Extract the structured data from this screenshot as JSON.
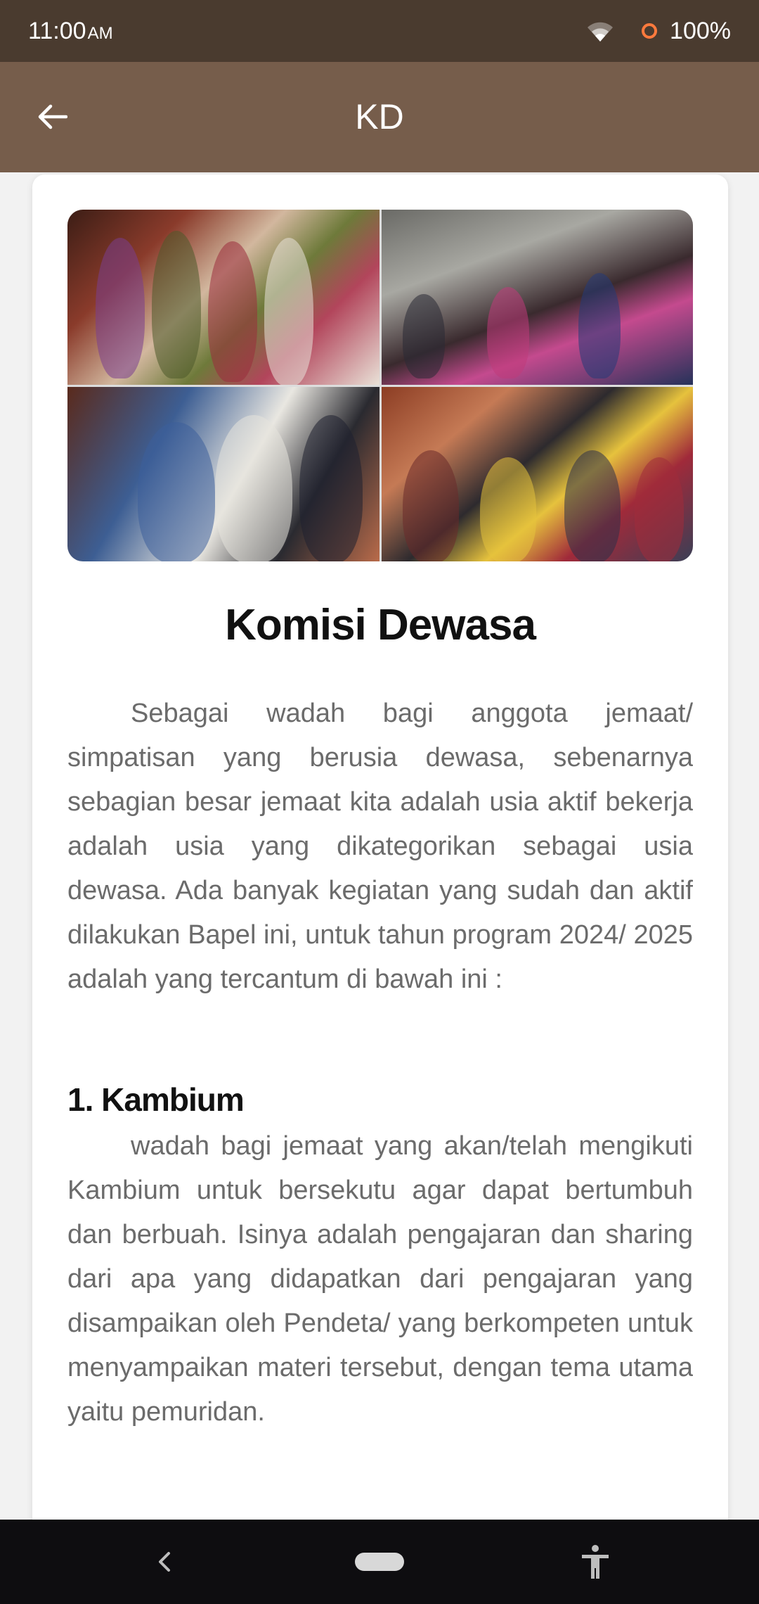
{
  "status_bar": {
    "time": "11:00",
    "ampm": "AM",
    "battery": "100%",
    "icons": [
      "wifi-icon",
      "battery-ring-icon"
    ]
  },
  "app_bar": {
    "title": "KD",
    "back_icon": "arrow-left-icon"
  },
  "article": {
    "hero_image": "collage of four congregation photos",
    "title": "Komisi Dewasa",
    "intro": "Sebagai wadah bagi anggota jemaat/ simpatisan yang berusia dewasa, sebenarnya sebagian besar jemaat kita adalah usia aktif bekerja adalah usia yang dikategorikan sebagai usia dewasa. Ada banyak kegiatan yang sudah dan aktif dilakukan Bapel ini, untuk tahun program 2024/ 2025 adalah yang tercantum di bawah ini :",
    "sections": [
      {
        "heading": "1. Kambium",
        "body": "wadah bagi jemaat yang akan/telah mengikuti Kambium untuk bersekutu agar dapat bertumbuh dan berbuah. Isinya adalah pengajaran dan sharing dari apa yang didapatkan dari pengajaran yang disampaikan oleh Pendeta/ yang berkompeten untuk menyampaikan materi tersebut, dengan tema utama yaitu pemuridan."
      }
    ]
  },
  "nav_bar": {
    "icons": [
      "nav-back-icon",
      "nav-home-pill",
      "accessibility-icon"
    ]
  },
  "colors": {
    "status_bar": "#4a3b2f",
    "app_bar": "#765d4b",
    "nav_bar": "#0e0d10",
    "body_text": "#6b6b6b",
    "heading_text": "#111111"
  }
}
